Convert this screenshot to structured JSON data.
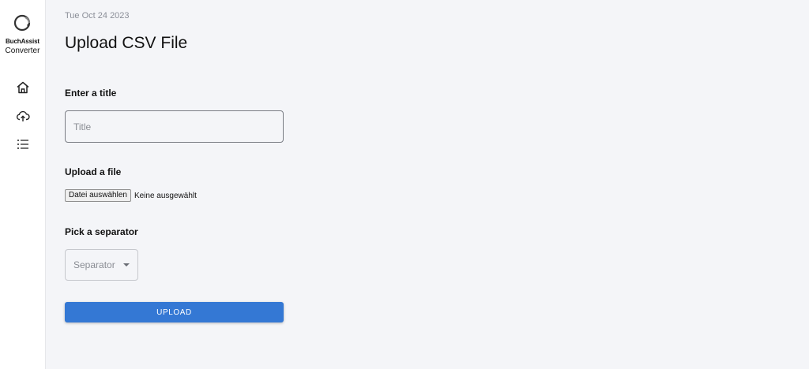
{
  "brand": {
    "name_line1": "BuchAssist",
    "name_line2": "Converter",
    "logo_icon": "circle-logo-icon"
  },
  "sidebar": {
    "items": [
      {
        "icon": "home-icon",
        "label": ""
      },
      {
        "icon": "cloud-upload-icon",
        "label": ""
      },
      {
        "icon": "list-icon",
        "label": ""
      }
    ]
  },
  "header": {
    "date": "Tue Oct 24 2023",
    "title": "Upload CSV File"
  },
  "form": {
    "title_label": "Enter a title",
    "title_placeholder": "Title",
    "title_value": "",
    "file_label": "Upload a file",
    "file_button": "Datei auswählen",
    "file_status": "Keine ausgewählt",
    "separator_label": "Pick a separator",
    "separator_placeholder": "Separator",
    "upload_button": "UPLOAD"
  },
  "colors": {
    "accent": "#3478d4",
    "background": "#f4f5f8",
    "sidebar": "#ffffff"
  }
}
